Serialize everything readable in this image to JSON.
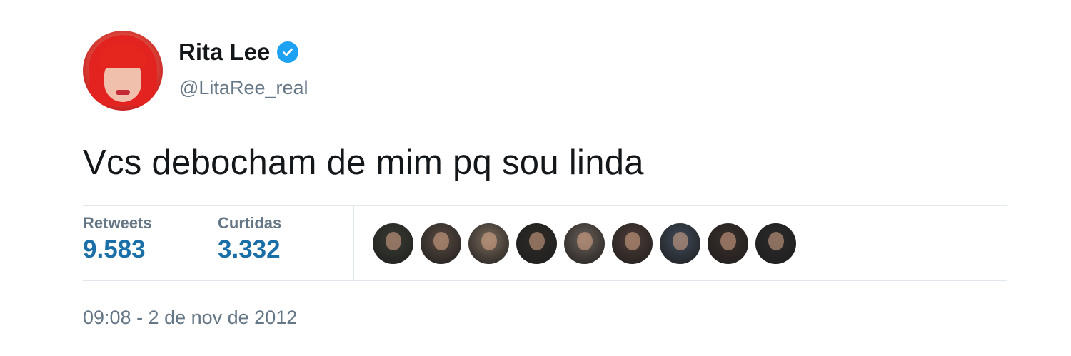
{
  "author": {
    "display_name": "Rita Lee",
    "handle": "@LitaRee_real",
    "verified": true
  },
  "tweet": {
    "text": "Vcs debocham de mim pq sou linda",
    "timestamp": "09:08 - 2 de nov de 2012"
  },
  "stats": {
    "retweets_label": "Retweets",
    "retweets_value": "9.583",
    "likes_label": "Curtidas",
    "likes_value": "3.332"
  },
  "likers": [
    {
      "icon": "avatar",
      "color": "#3a3a32"
    },
    {
      "icon": "avatar",
      "color": "#5a4a40"
    },
    {
      "icon": "avatar",
      "color": "#7a6a5a"
    },
    {
      "icon": "avatar",
      "color": "#2e2a26"
    },
    {
      "icon": "avatar",
      "color": "#6b5f57"
    },
    {
      "icon": "avatar",
      "color": "#4d3c36"
    },
    {
      "icon": "avatar",
      "color": "#3f4a5a"
    },
    {
      "icon": "avatar",
      "color": "#3a2e2a"
    },
    {
      "icon": "avatar",
      "color": "#2a2a2a"
    }
  ],
  "colors": {
    "verified_badge": "#1da1f2",
    "stat_value": "#1b6fa8",
    "secondary_text": "#657786"
  }
}
